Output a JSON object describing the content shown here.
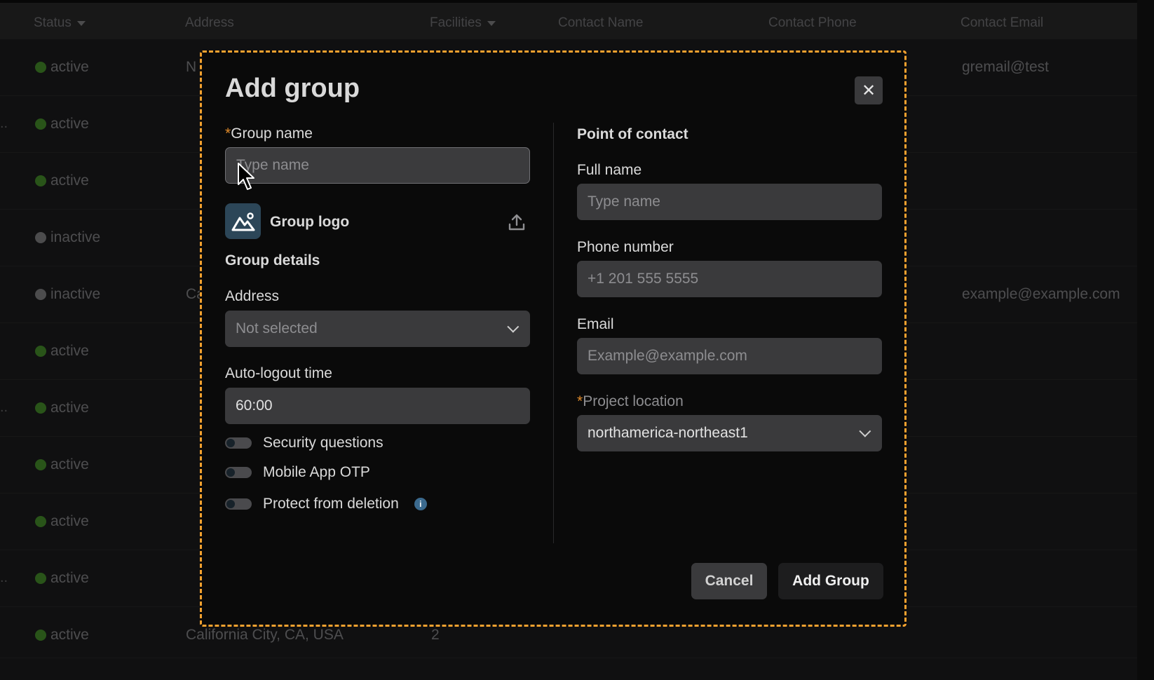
{
  "table": {
    "headers": [
      {
        "label": "Status",
        "sortable": true
      },
      {
        "label": "Address",
        "sortable": false
      },
      {
        "label": "Facilities",
        "sortable": true
      },
      {
        "label": "Contact Name",
        "sortable": false
      },
      {
        "label": "Contact Phone",
        "sortable": false
      },
      {
        "label": "Contact Email",
        "sortable": false
      }
    ],
    "rows": [
      {
        "status": "active",
        "address": "N",
        "facilities": "",
        "email": "gremail@test",
        "ellipsis": ""
      },
      {
        "status": "active",
        "address": "",
        "facilities": "",
        "email": "",
        "ellipsis": ".."
      },
      {
        "status": "active",
        "address": "",
        "facilities": "",
        "email": "",
        "ellipsis": ""
      },
      {
        "status": "inactive",
        "address": "",
        "facilities": "",
        "email": "",
        "ellipsis": ""
      },
      {
        "status": "inactive",
        "address": "Ca",
        "facilities": "",
        "email": "example@example.com",
        "ellipsis": ""
      },
      {
        "status": "active",
        "address": "",
        "facilities": "",
        "email": "",
        "ellipsis": ""
      },
      {
        "status": "active",
        "address": "",
        "facilities": "",
        "email": "",
        "ellipsis": ".."
      },
      {
        "status": "active",
        "address": "",
        "facilities": "",
        "email": "",
        "ellipsis": ""
      },
      {
        "status": "active",
        "address": "",
        "facilities": "",
        "email": "",
        "ellipsis": ""
      },
      {
        "status": "active",
        "address": "",
        "facilities": "",
        "email": "",
        "ellipsis": ".."
      },
      {
        "status": "active",
        "address": "California City, CA, USA",
        "facilities": "2",
        "email": "",
        "ellipsis": ""
      }
    ]
  },
  "modal": {
    "title": "Add group",
    "close_icon": "close-icon",
    "group_name": {
      "required_mark": "*",
      "label": "Group name",
      "placeholder": "Type name",
      "value": ""
    },
    "group_logo": {
      "label": "Group logo",
      "icon": "image-mountain-icon",
      "upload_icon": "upload-icon"
    },
    "group_details_title": "Group details",
    "address": {
      "label": "Address",
      "value": "Not selected"
    },
    "auto_logout": {
      "label": "Auto-logout time",
      "value": "60:00"
    },
    "toggles": [
      {
        "label": "Security questions",
        "on": false
      },
      {
        "label": "Mobile App OTP",
        "on": false
      },
      {
        "label": "Protect from deletion",
        "on": false,
        "info_icon": "i"
      }
    ],
    "point_of_contact": {
      "title": "Point of contact",
      "full_name": {
        "label": "Full name",
        "placeholder": "Type name"
      },
      "phone": {
        "label": "Phone number",
        "placeholder": "+1 201 555 5555"
      },
      "email": {
        "label": "Email",
        "placeholder": "Example@example.com"
      },
      "project_location": {
        "required_mark": "*",
        "label": "Project location",
        "value": "northamerica-northeast1"
      }
    },
    "buttons": {
      "cancel": "Cancel",
      "add": "Add Group"
    },
    "accent_border_color": "#f3a12f"
  }
}
